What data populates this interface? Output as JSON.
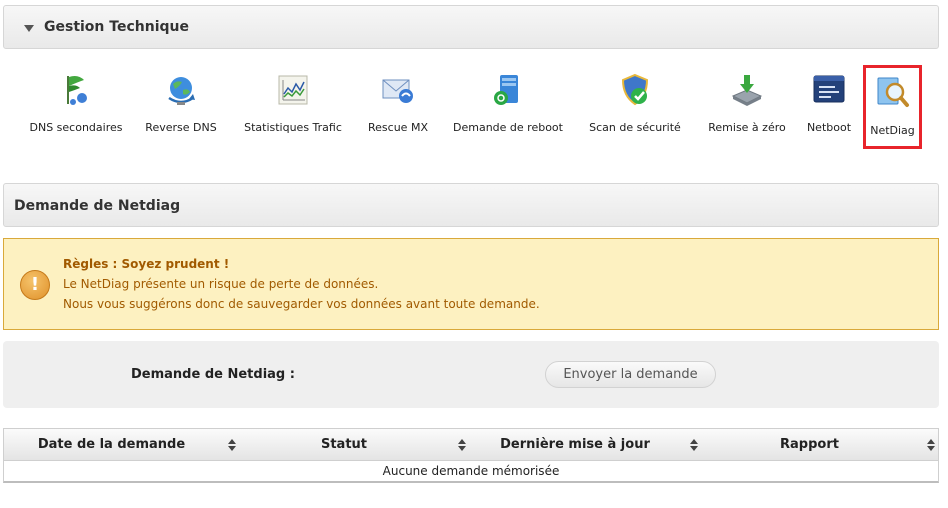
{
  "gestion": {
    "title": "Gestion Technique"
  },
  "tools": [
    {
      "id": "dns-secondaires",
      "label": "DNS secondaires",
      "icon": "flag-network-icon"
    },
    {
      "id": "reverse-dns",
      "label": "Reverse DNS",
      "icon": "globe-arrows-icon"
    },
    {
      "id": "statistiques-trafic",
      "label": "Statistiques Trafic",
      "icon": "chart-icon"
    },
    {
      "id": "rescue-mx",
      "label": "Rescue MX",
      "icon": "mail-icon"
    },
    {
      "id": "demande-reboot",
      "label": "Demande de reboot",
      "icon": "server-reboot-icon"
    },
    {
      "id": "scan-securite",
      "label": "Scan de sécurité",
      "icon": "shield-check-icon"
    },
    {
      "id": "remise-zero",
      "label": "Remise à zéro",
      "icon": "disk-download-icon"
    },
    {
      "id": "netboot",
      "label": "Netboot",
      "icon": "window-icon"
    },
    {
      "id": "netdiag",
      "label": "NetDiag",
      "icon": "magnifier-icon",
      "selected": true
    }
  ],
  "netdiag_section": {
    "title": "Demande de Netdiag"
  },
  "warning": {
    "title": "Règles : Soyez prudent !",
    "line1": "Le NetDiag présente un risque de perte de données.",
    "line2": "Nous vous suggérons donc de sauvegarder vos données avant toute demande.",
    "color": "#a15a00",
    "background": "#fdf1c1"
  },
  "form": {
    "label": "Demande de Netdiag :",
    "submit_label": "Envoyer la demande"
  },
  "table": {
    "columns": [
      "Date de la demande",
      "Statut",
      "Dernière mise à jour",
      "Rapport"
    ],
    "empty_message": "Aucune demande mémorisée"
  },
  "colors": {
    "selected_border": "#e8242b"
  }
}
